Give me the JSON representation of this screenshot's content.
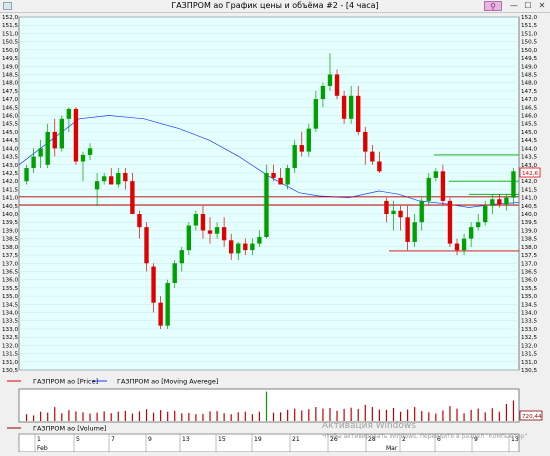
{
  "window": {
    "title": "ГАЗПРОМ ао График цены и объёма #2 - [4 часа]",
    "pin_glyph": "⚲",
    "min_glyph": "—",
    "max_glyph": "☐",
    "close_glyph": "✕"
  },
  "legend": {
    "price_label": "ГАЗПРОМ ао [Price]",
    "ma_label": "ГАЗПРОМ ао [Moving Averege]",
    "volume_label": "ГАЗПРОМ ао [Volume]"
  },
  "watermark": {
    "line1": "Активация Windows",
    "line2": "Чтобы активировать Windows, перейдите в раздел \"Компьютер\""
  },
  "colors": {
    "background": "#e5ffff",
    "up": "#00a000",
    "down": "#e00000",
    "ma": "#1e3cff",
    "hline_red": "#c80000",
    "hline_green": "#00a000",
    "price_tag": "#e00000",
    "volume_tag": "#8a0000"
  },
  "chart_data": {
    "type": "candlestick",
    "y_axis_ticks": [
      "152,0",
      "151,5",
      "151,0",
      "150,5",
      "150,0",
      "149,5",
      "149,0",
      "148,5",
      "148,0",
      "147,5",
      "147,0",
      "146,5",
      "146,0",
      "145,5",
      "145,0",
      "144,5",
      "144,0",
      "143,5",
      "143,0",
      "142,5",
      "142,0",
      "141,5",
      "141,0",
      "140,5",
      "140,0",
      "139,5",
      "139,0",
      "138,5",
      "138,0",
      "137,5",
      "137,0",
      "136,5",
      "136,0",
      "135,5",
      "135,0",
      "134,5",
      "134,0",
      "133,5",
      "133,0",
      "132,5",
      "132,0",
      "131,5",
      "131,0",
      "130,5"
    ],
    "ylim": [
      130.5,
      152.0
    ],
    "last_price": "142,6",
    "last_volume": "720,44",
    "candles": [
      [
        142,
        143,
        141.8,
        142.8
      ],
      [
        142.8,
        144,
        142.5,
        143.5
      ],
      [
        143.5,
        144.5,
        142.8,
        144
      ],
      [
        143,
        145.5,
        142.8,
        145
      ],
      [
        145,
        145.8,
        143.5,
        144
      ],
      [
        144,
        146,
        143.8,
        145.8
      ],
      [
        145.8,
        146.5,
        145,
        146.4
      ],
      [
        146.4,
        146.5,
        143,
        143.2
      ],
      [
        143.2,
        143.8,
        142,
        143.6
      ],
      [
        143.6,
        144.3,
        143.3,
        144
      ],
      [
        141.5,
        142.5,
        140.5,
        142
      ],
      [
        142,
        142.5,
        141.8,
        142.3
      ],
      [
        142.3,
        142.8,
        141.8,
        141.8
      ],
      [
        141.8,
        142.8,
        141.6,
        142.5
      ],
      [
        142.5,
        142.8,
        141.5,
        142
      ],
      [
        142,
        142.5,
        140,
        140
      ],
      [
        140,
        140.2,
        138.5,
        139.2
      ],
      [
        139.2,
        139.5,
        136.5,
        137
      ],
      [
        136.8,
        137,
        134,
        134.6
      ],
      [
        134.6,
        135,
        133,
        133.2
      ],
      [
        133.2,
        136,
        133,
        135.8
      ],
      [
        135.8,
        137.2,
        135.5,
        137
      ],
      [
        137,
        138,
        136.5,
        137.8
      ],
      [
        137.8,
        139.5,
        137.5,
        139.3
      ],
      [
        139.3,
        140.2,
        139,
        140
      ],
      [
        140,
        140.5,
        138.5,
        139
      ],
      [
        139,
        139.8,
        138.2,
        138.8
      ],
      [
        138.8,
        139.5,
        138.5,
        139.2
      ],
      [
        139.2,
        139.8,
        138,
        138.4
      ],
      [
        138.4,
        138.8,
        137.2,
        137.6
      ],
      [
        137.6,
        138.3,
        137.2,
        138.2
      ],
      [
        138.2,
        138.5,
        137.5,
        137.8
      ],
      [
        137.8,
        138.5,
        137.5,
        138.2
      ],
      [
        138.2,
        139,
        138,
        138.6
      ],
      [
        138.6,
        143,
        138.5,
        142.5
      ],
      [
        142.5,
        143,
        142,
        142.2
      ],
      [
        142.2,
        142.8,
        141.8,
        141.8
      ],
      [
        141.8,
        143,
        141.5,
        142.8
      ],
      [
        142.8,
        144.5,
        142.5,
        144.2
      ],
      [
        144.2,
        145,
        143.5,
        143.8
      ],
      [
        143.8,
        145.5,
        143.5,
        145.2
      ],
      [
        145.2,
        147.5,
        145,
        147
      ],
      [
        147,
        148,
        146.5,
        147.8
      ],
      [
        147.8,
        149.8,
        147.5,
        148.5
      ],
      [
        148.5,
        148.8,
        147,
        147.2
      ],
      [
        147.2,
        147.5,
        145.5,
        145.8
      ],
      [
        145.8,
        147.8,
        145.5,
        147.2
      ],
      [
        147.2,
        147.8,
        144.8,
        145
      ],
      [
        145,
        145.3,
        143,
        143.8
      ],
      [
        143.8,
        144.2,
        143,
        143.2
      ],
      [
        143.2,
        143.8,
        142.5,
        142.6
      ],
      [
        140.8,
        141,
        139.5,
        140
      ],
      [
        140,
        140.8,
        139,
        140.2
      ],
      [
        140.2,
        140.5,
        139,
        139.8
      ],
      [
        139.8,
        140.5,
        137.8,
        138.3
      ],
      [
        138.3,
        140,
        138,
        139.5
      ],
      [
        139.5,
        141,
        139,
        140.8
      ],
      [
        140.8,
        142.5,
        140.5,
        142.2
      ],
      [
        142.2,
        142.8,
        142,
        142.6
      ],
      [
        142.6,
        143,
        140.5,
        140.8
      ],
      [
        140.8,
        141,
        138,
        138.2
      ],
      [
        138.2,
        138.5,
        137.5,
        137.8
      ],
      [
        137.8,
        138.8,
        137.5,
        138.5
      ],
      [
        138.5,
        139.5,
        138,
        139.2
      ],
      [
        139.2,
        140,
        139,
        139.5
      ],
      [
        139.5,
        140.8,
        139.3,
        140.5
      ],
      [
        140.5,
        141.2,
        140,
        140.9
      ],
      [
        140.9,
        141.2,
        140.4,
        140.6
      ],
      [
        140.6,
        141.2,
        140.2,
        141
      ],
      [
        141,
        142.8,
        140.6,
        142.6
      ]
    ],
    "moving_average": [
      [
        0,
        143.0
      ],
      [
        0.06,
        144.4
      ],
      [
        0.12,
        145.8
      ],
      [
        0.18,
        146.0
      ],
      [
        0.25,
        145.8
      ],
      [
        0.32,
        145.2
      ],
      [
        0.38,
        144.5
      ],
      [
        0.44,
        143.5
      ],
      [
        0.5,
        142.3
      ],
      [
        0.56,
        141.3
      ],
      [
        0.6,
        141.1
      ],
      [
        0.66,
        141.0
      ],
      [
        0.72,
        141.4
      ],
      [
        0.76,
        141.2
      ],
      [
        0.8,
        140.8
      ],
      [
        0.86,
        140.6
      ],
      [
        0.9,
        140.4
      ],
      [
        0.95,
        140.6
      ],
      [
        1.0,
        140.7
      ]
    ],
    "horizontal_lines": [
      {
        "price": 141.05,
        "color": "#c80000",
        "x0": 0,
        "x1": 1
      },
      {
        "price": 140.55,
        "color": "#c80000",
        "x0": 0,
        "x1": 1
      },
      {
        "price": 137.75,
        "color": "#c80000",
        "x0": 0.74,
        "x1": 1
      },
      {
        "price": 143.6,
        "color": "#00a000",
        "x0": 0.83,
        "x1": 1
      },
      {
        "price": 142.0,
        "color": "#00a000",
        "x0": 0.86,
        "x1": 1
      },
      {
        "price": 141.2,
        "color": "#00a000",
        "x0": 0.9,
        "x1": 1
      }
    ],
    "volumes": [
      0.22,
      0.18,
      0.3,
      0.27,
      0.45,
      0.25,
      0.35,
      0.31,
      0.28,
      0.24,
      0.27,
      0.31,
      0.25,
      0.3,
      0.33,
      0.24,
      0.31,
      0.38,
      0.27,
      0.35,
      0.3,
      0.33,
      0.25,
      0.26,
      0.22,
      0.23,
      0.31,
      0.32,
      0.25,
      0.22,
      0.28,
      0.3,
      0.22,
      0.3,
      0.95,
      0.27,
      0.28,
      0.36,
      0.4,
      0.34,
      0.38,
      0.45,
      0.4,
      0.42,
      0.33,
      0.39,
      0.43,
      0.39,
      0.52,
      0.45,
      0.37,
      0.36,
      0.42,
      0.3,
      0.37,
      0.45,
      0.32,
      0.28,
      0.24,
      0.34,
      0.48,
      0.4,
      0.25,
      0.36,
      0.4,
      0.28,
      0.41,
      0.3,
      0.55,
      0.66
    ],
    "x_day_labels": [
      "1",
      "5",
      "7",
      "9",
      "13",
      "15",
      "19",
      "21",
      "26",
      "28",
      "2",
      "6",
      "9",
      "13"
    ],
    "x_month_labels": [
      "Feb",
      "Mar"
    ]
  }
}
